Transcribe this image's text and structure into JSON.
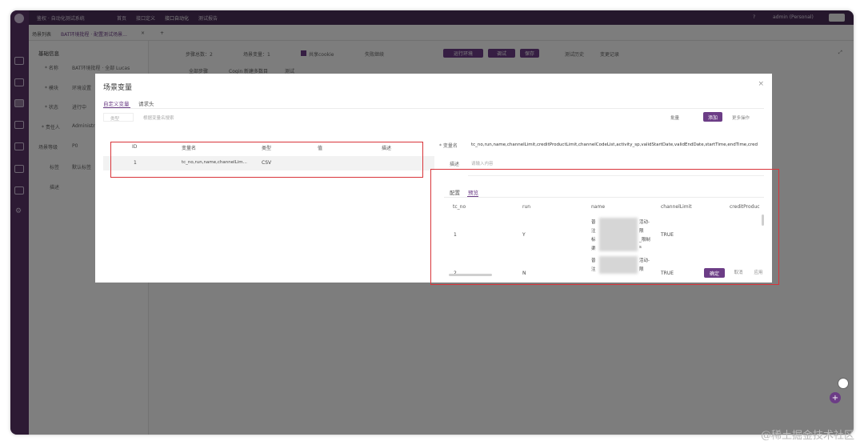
{
  "topbar": {
    "title": "鉴权 · 自动化测试系统",
    "nav": [
      "首页",
      "接口定义",
      "接口自动化",
      "测试报告"
    ],
    "user": "admin (Personal)"
  },
  "tabs": {
    "items": [
      "场景列表",
      "BAT环境批程 · 配置测试场景..."
    ]
  },
  "leftpanel": {
    "section": "基础信息",
    "rows": [
      {
        "label": "* 名称",
        "value": "BAT环境批程 · 全部 Lucas"
      },
      {
        "label": "* 模块",
        "value": "环境设置"
      },
      {
        "label": "* 状态",
        "value": "进行中"
      },
      {
        "label": "* 责任人",
        "value": "Administrator"
      },
      {
        "label": "场景等级",
        "value": "P0"
      },
      {
        "label": "标签",
        "value": "默认标签"
      },
      {
        "label": "描述",
        "value": ""
      }
    ]
  },
  "mainbar": {
    "steps": "步骤总数：2",
    "vars": "场景变量：1",
    "share_cookie": "共享cookie",
    "fail_continue": "失败继续",
    "env_btn": "运行环境",
    "debug_btn": "调试",
    "save_btn": "保存",
    "history": "测试历史",
    "changes": "变更记录",
    "sub1": "全部步骤",
    "sub2": "Cogin 新建多数目",
    "sub3": "测试"
  },
  "modal": {
    "title": "场景变量",
    "tabs": [
      "自定义变量",
      "请求头"
    ],
    "filter_label": "类型",
    "search_placeholder": "根据变量名搜索",
    "batch_label": "批量",
    "add_button": "添加",
    "more_label": "更多操作",
    "table": {
      "headers": [
        "ID",
        "变量名",
        "类型",
        "值",
        "描述"
      ],
      "rows": [
        {
          "id": "1",
          "name": "tc_no,run,name,channelLim...",
          "type": "CSV",
          "value": "",
          "desc": ""
        }
      ]
    },
    "detail": {
      "name_label": "* 变量名",
      "name_value": "tc_no,run,name,channelLimit,creditProductLimit,channelCodeList,activity_sp,validStartDate,validEndDate,startTime,endTime,cred",
      "desc_label": "描述",
      "desc_placeholder": "请输入内容"
    },
    "preview": {
      "tabs": [
        "配置",
        "预览"
      ],
      "headers": [
        "tc_no",
        "run",
        "name",
        "channelLimit",
        "creditProduc"
      ],
      "rows": [
        {
          "tc_no": "1",
          "run": "Y",
          "name_lines": [
            "普",
            "注",
            "标",
            "渠"
          ],
          "name_tail": [
            "活动-",
            "限",
            "_限制",
            "s"
          ],
          "channelLimit": "TRUE"
        },
        {
          "tc_no": "2",
          "run": "N",
          "name_lines": [
            "普",
            "注"
          ],
          "name_tail": [
            "活动-",
            "限"
          ],
          "channelLimit": "TRUE"
        }
      ]
    },
    "footer": {
      "confirm": "确定",
      "cancel": "取消",
      "apply": "应用"
    }
  },
  "watermark": "@稀土掘金技术社区",
  "colors": {
    "accent": "#6c3d86",
    "highlight_border": "#d9343a",
    "sidebar": "#5a3569"
  }
}
